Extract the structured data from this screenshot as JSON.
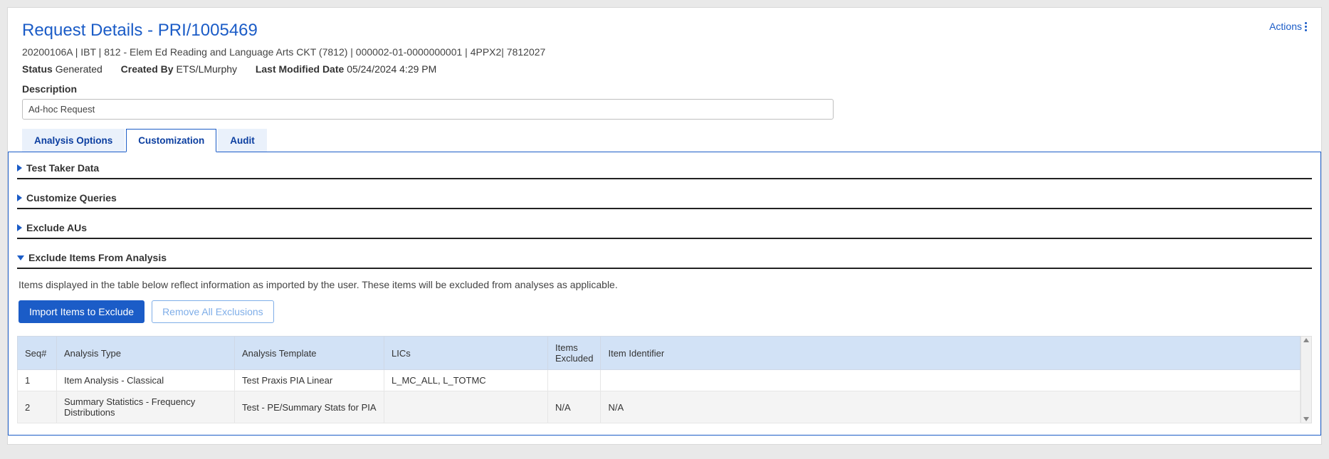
{
  "header": {
    "title": "Request Details - PRI/1005469",
    "actions_label": "Actions",
    "breadcrumb": "20200106A | IBT | 812 - Elem Ed Reading and Language Arts CKT (7812) | 000002-01-0000000001 | 4PPX2| 7812027",
    "status_label": "Status",
    "status_value": "Generated",
    "created_by_label": "Created By",
    "created_by_value": "ETS/LMurphy",
    "last_mod_label": "Last Modified Date",
    "last_mod_value": "05/24/2024 4:29 PM"
  },
  "description": {
    "label": "Description",
    "value": "Ad-hoc Request"
  },
  "tabs": {
    "analysis_options": "Analysis Options",
    "customization": "Customization",
    "audit": "Audit"
  },
  "accordions": {
    "test_taker": "Test Taker Data",
    "customize_queries": "Customize Queries",
    "exclude_aus": "Exclude AUs",
    "exclude_items": "Exclude Items From Analysis"
  },
  "exclude_section": {
    "info": "Items displayed in the table below reflect information as imported by the user. These items will be excluded from analyses as applicable.",
    "import_btn": "Import Items to Exclude",
    "remove_btn": "Remove All Exclusions"
  },
  "table": {
    "headers": {
      "seq": "Seq#",
      "analysis_type": "Analysis Type",
      "analysis_template": "Analysis Template",
      "lics": "LICs",
      "items_excluded": "Items Excluded",
      "item_identifier": "Item Identifier"
    },
    "rows": [
      {
        "seq": "1",
        "analysis_type": "Item Analysis - Classical",
        "analysis_template": "Test Praxis PIA Linear",
        "lics": "L_MC_ALL, L_TOTMC",
        "items_excluded": "",
        "item_identifier": ""
      },
      {
        "seq": "2",
        "analysis_type": "Summary Statistics - Frequency Distributions",
        "analysis_template": "Test - PE/Summary Stats for PIA",
        "lics": "",
        "items_excluded": "N/A",
        "item_identifier": "N/A"
      }
    ]
  }
}
